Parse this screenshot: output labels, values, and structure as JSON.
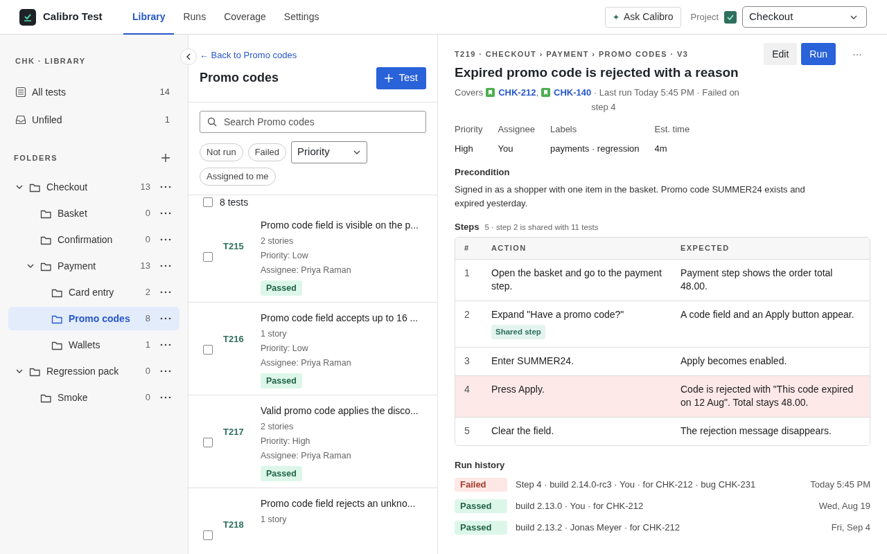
{
  "app": {
    "name": "Calibro Test"
  },
  "nav": [
    {
      "label": "Library",
      "selected": true
    },
    {
      "label": "Runs",
      "selected": false
    },
    {
      "label": "Coverage",
      "selected": false
    },
    {
      "label": "Settings",
      "selected": false
    }
  ],
  "ask_button": {
    "icon": "✦",
    "label": "Ask Calibro"
  },
  "project": {
    "label": "Project",
    "value": "Checkout"
  },
  "sidebar": {
    "heading": "CHK · LIBRARY",
    "items": [
      {
        "kind": "list",
        "label": "All tests",
        "count": "14"
      },
      {
        "kind": "inbox",
        "label": "Unfiled",
        "count": "1"
      }
    ],
    "folders_heading": "FOLDERS",
    "folders": [
      {
        "label": "Checkout",
        "count": "13",
        "selected": false,
        "expanded": true,
        "children": [
          {
            "label": "Basket",
            "count": "0",
            "selected": false
          },
          {
            "label": "Confirmation",
            "count": "0",
            "selected": false
          },
          {
            "label": "Payment",
            "count": "13",
            "selected": false,
            "expanded": true,
            "children": [
              {
                "label": "Card entry",
                "count": "2",
                "selected": false
              },
              {
                "label": "Promo codes",
                "count": "8",
                "selected": true
              },
              {
                "label": "Wallets",
                "count": "1",
                "selected": false
              }
            ]
          }
        ]
      },
      {
        "label": "Regression pack",
        "count": "0",
        "selected": false,
        "expanded": true,
        "children": [
          {
            "label": "Smoke",
            "count": "0",
            "selected": false
          }
        ]
      }
    ]
  },
  "list_panel": {
    "back_link": "← Back to Promo codes",
    "title": "Promo codes",
    "add_button": "Test",
    "search": {
      "placeholder": "Search Promo codes"
    },
    "filters": [
      {
        "kind": "chip",
        "label": "Not run"
      },
      {
        "kind": "chip",
        "label": "Failed"
      },
      {
        "kind": "select",
        "label": "Priority"
      },
      {
        "kind": "chip",
        "label": "Assigned to me"
      }
    ],
    "select_all": {
      "label": "8 tests",
      "checked": false
    },
    "tests": [
      {
        "id": "T215",
        "title": "Promo code field is visible on the p...",
        "stories": "2 stories",
        "priority": "Priority: Low",
        "assignee": "Assignee: Priya Raman",
        "status": {
          "kind": "passed",
          "label": "Passed"
        },
        "checked": false
      },
      {
        "id": "T216",
        "title": "Promo code field accepts up to 16 ...",
        "stories": "1 story",
        "priority": "Priority: Low",
        "assignee": "Assignee: Priya Raman",
        "status": {
          "kind": "passed",
          "label": "Passed"
        },
        "checked": false
      },
      {
        "id": "T217",
        "title": "Valid promo code applies the disco...",
        "stories": "2 stories",
        "priority": "Priority: High",
        "assignee": "Assignee: Priya Raman",
        "status": {
          "kind": "passed",
          "label": "Passed"
        },
        "checked": false
      },
      {
        "id": "T218",
        "title": "Promo code field rejects an unkno...",
        "stories": "1 story",
        "checked": false
      }
    ]
  },
  "detail": {
    "breadcrumb": "T219 · CHECKOUT › PAYMENT › PROMO CODES · V3",
    "title": "Expired promo code is rejected with a reason",
    "edit_button": "Edit",
    "run_button": "Run",
    "more_button": "···",
    "covers_label": "Covers",
    "covers": [
      "CHK-212",
      "CHK-140"
    ],
    "covers_separator": ",",
    "run_info": " · Last run Today 5:45 PM · Failed on step 4",
    "fields": [
      {
        "label": "Priority",
        "value": "High"
      },
      {
        "label": "Assignee",
        "value": "You"
      },
      {
        "label": "Labels",
        "value": "payments · regression"
      },
      {
        "label": "Est. time",
        "value": "4m"
      }
    ],
    "precondition": {
      "heading": "Precondition",
      "text": "Signed in as a shopper with one item in the basket. Promo code SUMMER24 exists and expired yesterday."
    },
    "steps": {
      "heading": "Steps",
      "note": "5 · step 2 is shared with 11 tests",
      "columns": [
        "#",
        "ACTION",
        "EXPECTED"
      ],
      "rows": [
        {
          "number": "1",
          "action": "Open the basket and go to the payment step.",
          "expected": "Payment step shows the order total 48.00.",
          "failed": false
        },
        {
          "number": "2",
          "action": "Expand \"Have a promo code?\"",
          "badge": "Shared step",
          "expected": "A code field and an Apply button appear.",
          "failed": false
        },
        {
          "number": "3",
          "action": "Enter SUMMER24.",
          "expected": "Apply becomes enabled.",
          "failed": false
        },
        {
          "number": "4",
          "action": "Press Apply.",
          "expected": "Code is rejected with \"This code expired on 12 Aug\". Total stays 48.00.",
          "failed": true
        },
        {
          "number": "5",
          "action": "Clear the field.",
          "expected": "The rejection message disappears.",
          "failed": false
        }
      ]
    },
    "run_history": {
      "heading": "Run history",
      "runs": [
        {
          "result": {
            "kind": "failed",
            "label": "Failed"
          },
          "summary": "Step 4 · build 2.14.0-rc3 · You · for CHK-212 · bug CHK-231",
          "date": "Today 5:45 PM"
        },
        {
          "result": {
            "kind": "passed",
            "label": "Passed"
          },
          "summary": "build 2.13.0 · You · for CHK-212",
          "date": "Wed, Aug 19"
        },
        {
          "result": {
            "kind": "passed",
            "label": "Passed"
          },
          "summary": "build 2.13.2 · Jonas Meyer · for CHK-212",
          "date": "Fri, Sep 4"
        }
      ]
    }
  }
}
